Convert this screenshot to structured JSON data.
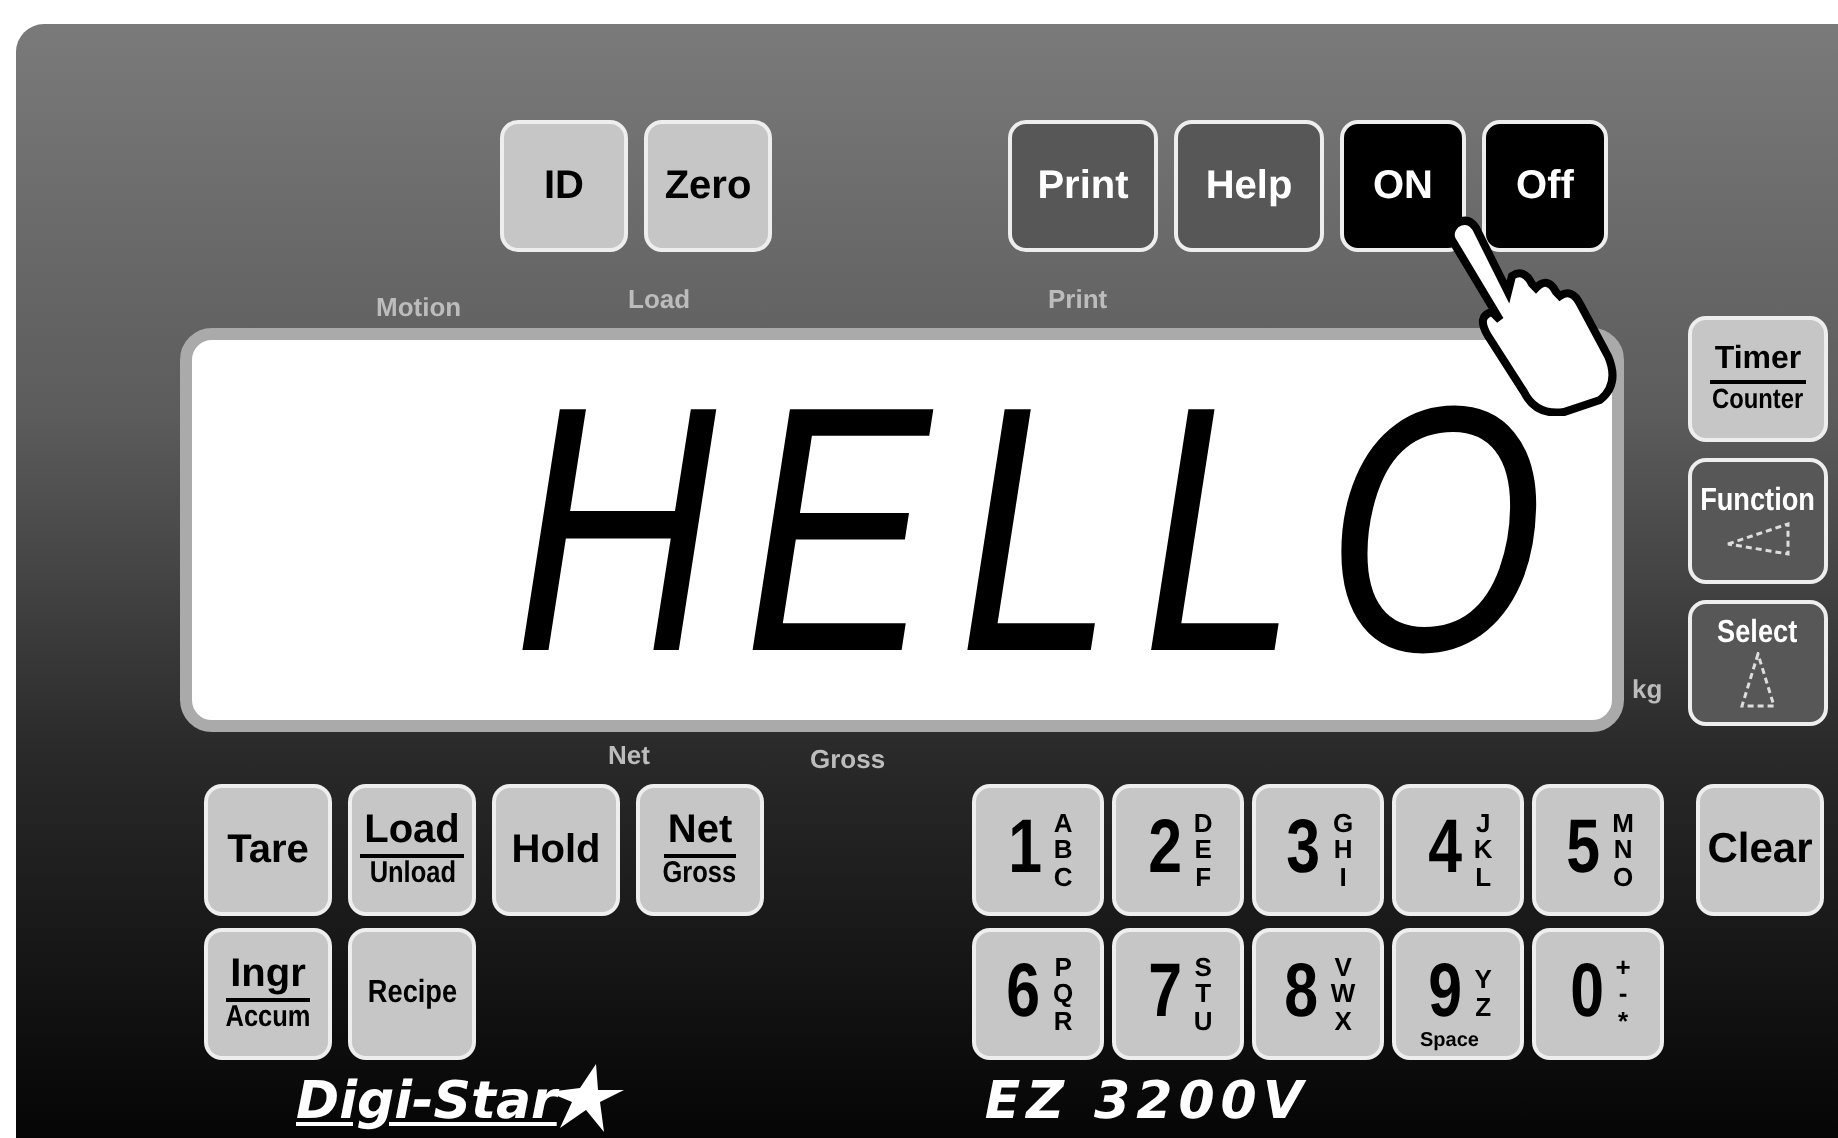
{
  "top_keys": [
    {
      "label": "ID",
      "kind": "light"
    },
    {
      "label": "Zero",
      "kind": "light"
    }
  ],
  "top_right_keys": [
    {
      "label": "Print",
      "kind": "dark"
    },
    {
      "label": "Help",
      "kind": "dark"
    },
    {
      "label": "ON",
      "kind": "black"
    },
    {
      "label": "Off",
      "kind": "black"
    }
  ],
  "indicators_top": [
    "Motion",
    "Load",
    "Print"
  ],
  "display": {
    "text": "HELLO",
    "unit": "kg"
  },
  "indicators_bottom": [
    "Net",
    "Gross"
  ],
  "side_keys": [
    {
      "label": "Timer",
      "sublabel": "Counter",
      "kind": "light"
    },
    {
      "label": "Function",
      "kind": "dark"
    },
    {
      "label": "Select",
      "kind": "dark"
    }
  ],
  "function_keys": [
    [
      {
        "label": "Tare",
        "kind": "light"
      },
      {
        "label": "Load",
        "sublabel": "Unload",
        "kind": "light"
      },
      {
        "label": "Hold",
        "kind": "light"
      },
      {
        "label": "Net",
        "sublabel": "Gross",
        "kind": "light"
      }
    ],
    [
      {
        "label": "Ingr",
        "sublabel": "Accum",
        "kind": "light"
      },
      {
        "label": "Recipe",
        "kind": "light"
      }
    ]
  ],
  "number_keys": [
    [
      {
        "digit": "1",
        "letters": "ABC"
      },
      {
        "digit": "2",
        "letters": "DEF"
      },
      {
        "digit": "3",
        "letters": "GHI"
      },
      {
        "digit": "4",
        "letters": "JKL"
      },
      {
        "digit": "5",
        "letters": "MNO"
      }
    ],
    [
      {
        "digit": "6",
        "letters": "PQR"
      },
      {
        "digit": "7",
        "letters": "STU"
      },
      {
        "digit": "8",
        "letters": "VWX"
      },
      {
        "digit": "9",
        "letters": "YZ",
        "extra": "Space"
      },
      {
        "digit": "0",
        "letters": "+-*"
      }
    ]
  ],
  "clear_key": {
    "label": "Clear",
    "kind": "light"
  },
  "brand": "Digi-Star",
  "model": "EZ 3200V"
}
